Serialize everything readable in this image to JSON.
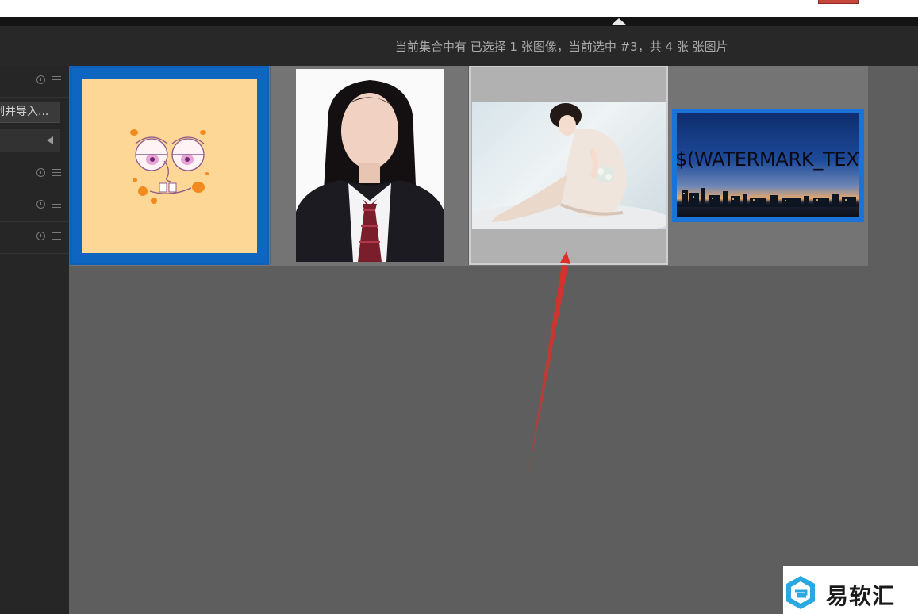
{
  "window": {
    "collapse_toggle": "collapse-panel-triangle"
  },
  "status_bar": {
    "text": "当前集合中有 已选择 1 张图像，当前选中 #3，共 4 张 张图片"
  },
  "sidebar": {
    "import_button_label": "制并导入...",
    "rows": [
      {
        "info_icon": "info-icon",
        "menu_icon": "menu-icon"
      },
      {
        "info_icon": "info-icon",
        "menu_icon": "menu-icon"
      },
      {
        "info_icon": "info-icon",
        "menu_icon": "menu-icon"
      },
      {
        "info_icon": "info-icon",
        "menu_icon": "menu-icon"
      }
    ],
    "dropdown_icon": "triangle-left-icon"
  },
  "grid": {
    "thumbnails": [
      {
        "index": 1,
        "content": "spongebob-face",
        "selected": true
      },
      {
        "index": 2,
        "content": "id-photo-portrait",
        "selected": false
      },
      {
        "index": 3,
        "content": "woman-seated-photo",
        "selected": true,
        "current": true
      },
      {
        "index": 4,
        "content": "city-skyline-watermark",
        "selected": true,
        "overlay_text": "$(WATERMARK_TEXT)"
      }
    ]
  },
  "watermark_logo": {
    "text": "易软汇"
  },
  "colors": {
    "selection_blue": "#0d61b8",
    "annotation_arrow": "#d9302a",
    "current_border": "#cfcfcf",
    "background": "#5e5e5e"
  }
}
